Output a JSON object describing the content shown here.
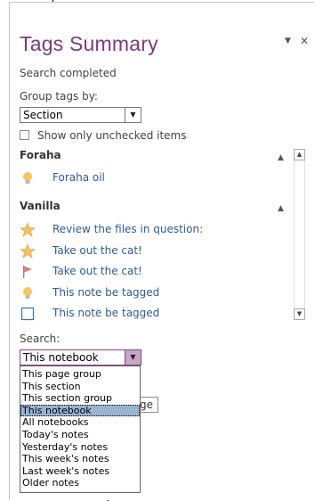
{
  "pane": {
    "title": "Tags Summary",
    "dropdown_arrow": "▼",
    "close": "✕"
  },
  "status_text": "Search completed",
  "group_by": {
    "label": "Group tags by:",
    "value": "Section"
  },
  "show_unchecked": {
    "label": "Show only unchecked items",
    "checked": false
  },
  "groups": [
    {
      "name": "Foraha",
      "collapse_icon": "chevron-up-icon",
      "items": [
        {
          "icon": "lightbulb-icon",
          "label": "Foraha oil"
        }
      ]
    },
    {
      "name": "Vanilla",
      "collapse_icon": "chevron-up-icon",
      "items": [
        {
          "icon": "star-icon",
          "label": "Review the files in question:"
        },
        {
          "icon": "star-icon",
          "label": "Take out the cat!"
        },
        {
          "icon": "flag-icon",
          "label": "Take out the cat!"
        },
        {
          "icon": "lightbulb-icon",
          "label": "This note be tagged"
        },
        {
          "icon": "checkbox-icon",
          "label": "This note be tagged"
        }
      ]
    }
  ],
  "search": {
    "label": "Search:",
    "value": "This notebook",
    "options": [
      "This page group",
      "This section",
      "This section group",
      "This notebook",
      "All notebooks",
      "Today's notes",
      "Yesterday's notes",
      "This week's notes",
      "Last week's notes",
      "Older notes"
    ],
    "selected_index": 3
  },
  "obscured_button_fragment": "ge",
  "colors": {
    "title": "#80397b",
    "tag_link": "#2e5b9b",
    "selection": "#99b4d1",
    "star": "#f0c165",
    "lightbulb": "#f3c85b",
    "flag": "#e07c7c"
  }
}
